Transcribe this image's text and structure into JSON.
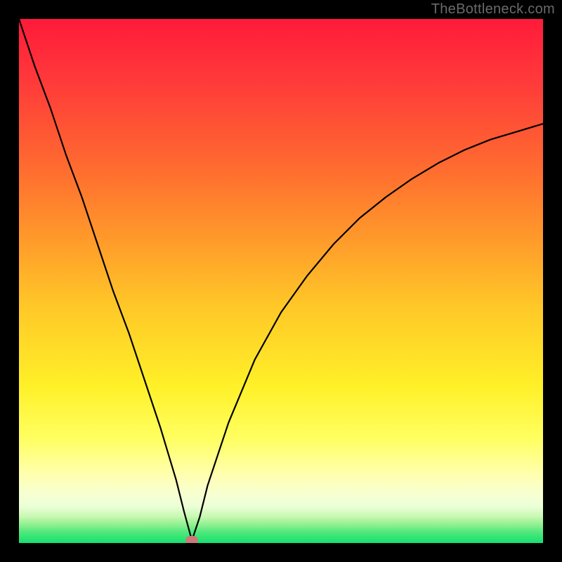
{
  "watermark": "TheBottleneck.com",
  "chart_data": {
    "type": "line",
    "title": "",
    "xlabel": "",
    "ylabel": "",
    "xlim": [
      0,
      100
    ],
    "ylim": [
      0,
      100
    ],
    "grid": false,
    "legend": false,
    "background_gradient": {
      "direction": "vertical",
      "stops": [
        {
          "pos": 0,
          "color": "#ff1a3a"
        },
        {
          "pos": 28,
          "color": "#ff6a30"
        },
        {
          "pos": 55,
          "color": "#ffc828"
        },
        {
          "pos": 80,
          "color": "#ffff60"
        },
        {
          "pos": 93,
          "color": "#ecffd8"
        },
        {
          "pos": 100,
          "color": "#14e070"
        }
      ]
    },
    "series": [
      {
        "name": "bottleneck-curve",
        "color": "#000000",
        "x": [
          0,
          3,
          6,
          9,
          12,
          15,
          18,
          21,
          24,
          27,
          30,
          31.5,
          33,
          34.5,
          36,
          40,
          45,
          50,
          55,
          60,
          65,
          70,
          75,
          80,
          85,
          90,
          95,
          100
        ],
        "y": [
          100,
          91,
          83,
          74,
          66,
          57,
          48,
          40,
          31,
          22,
          12,
          6,
          0.5,
          5,
          11,
          23,
          35,
          44,
          51,
          57,
          62,
          66,
          69.5,
          72.5,
          75,
          77,
          78.5,
          80
        ]
      }
    ],
    "markers": [
      {
        "name": "min-marker",
        "x": 33,
        "y": 0.5,
        "color": "#c97a78"
      }
    ]
  }
}
